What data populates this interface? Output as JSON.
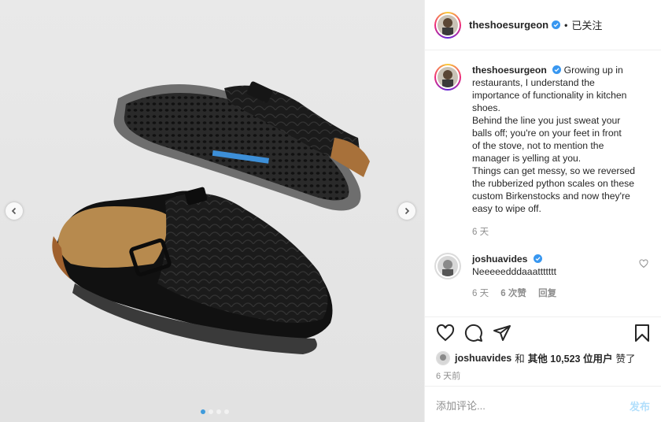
{
  "post": {
    "author": "theshoesurgeon",
    "follow_label": "已关注",
    "separator": "•"
  },
  "caption": {
    "author": "theshoesurgeon",
    "lines": [
      "Growing up in",
      "restaurants, I understand the",
      "importance of functionality in kitchen",
      "shoes.",
      "Behind the line you just sweat your",
      "balls off; you're on your feet in front",
      "of the stove, not to mention the",
      "manager is yelling at you.",
      "Things can get messy, so we reversed",
      "the rubberized python scales on these",
      "custom Birkenstocks and now they're",
      "easy to wipe off."
    ],
    "age": "6 天"
  },
  "comment": {
    "author": "joshuavides",
    "text": "Neeeeedddaaattttttt",
    "age": "6 天",
    "likes": "6 次赞",
    "reply": "回复"
  },
  "likes_line": {
    "user": "joshuavides",
    "middle": "和",
    "others": "其他 10,523 位用户",
    "suffix": "赞了"
  },
  "posted_ago": "6 天前",
  "add_comment": {
    "placeholder": "添加评论...",
    "post_label": "发布"
  },
  "carousel": {
    "slides": 4,
    "active_index": 0
  },
  "colors": {
    "verified": "#3897f0",
    "link_disabled": "#b2dffc",
    "muted": "#8e8e8e"
  },
  "icons": [
    "heart-icon",
    "comment-icon",
    "share-icon",
    "bookmark-icon",
    "chevron-left-icon",
    "chevron-right-icon",
    "verified-badge-icon"
  ]
}
